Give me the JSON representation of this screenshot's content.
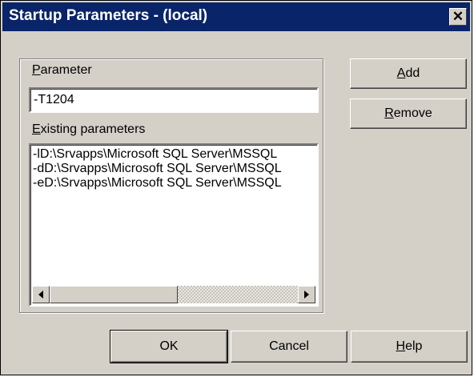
{
  "window": {
    "title": "Startup Parameters - (local)",
    "close_glyph": "✕"
  },
  "parameter": {
    "label_first": "P",
    "label_rest": "arameter",
    "value": "-T1204"
  },
  "existing": {
    "label_first": "E",
    "label_rest": "xisting parameters",
    "items": [
      "-lD:\\Srvapps\\Microsoft SQL Server\\MSSQL",
      "-dD:\\Srvapps\\Microsoft SQL Server\\MSSQL",
      "-eD:\\Srvapps\\Microsoft SQL Server\\MSSQL"
    ]
  },
  "buttons": {
    "add": {
      "first": "A",
      "rest": "dd"
    },
    "remove": {
      "first": "R",
      "rest": "emove"
    },
    "ok": "OK",
    "cancel": "Cancel",
    "help": {
      "first": "H",
      "rest": "elp"
    }
  },
  "scrollbar": {
    "left_icon": "scroll-left-arrow",
    "right_icon": "scroll-right-arrow"
  }
}
